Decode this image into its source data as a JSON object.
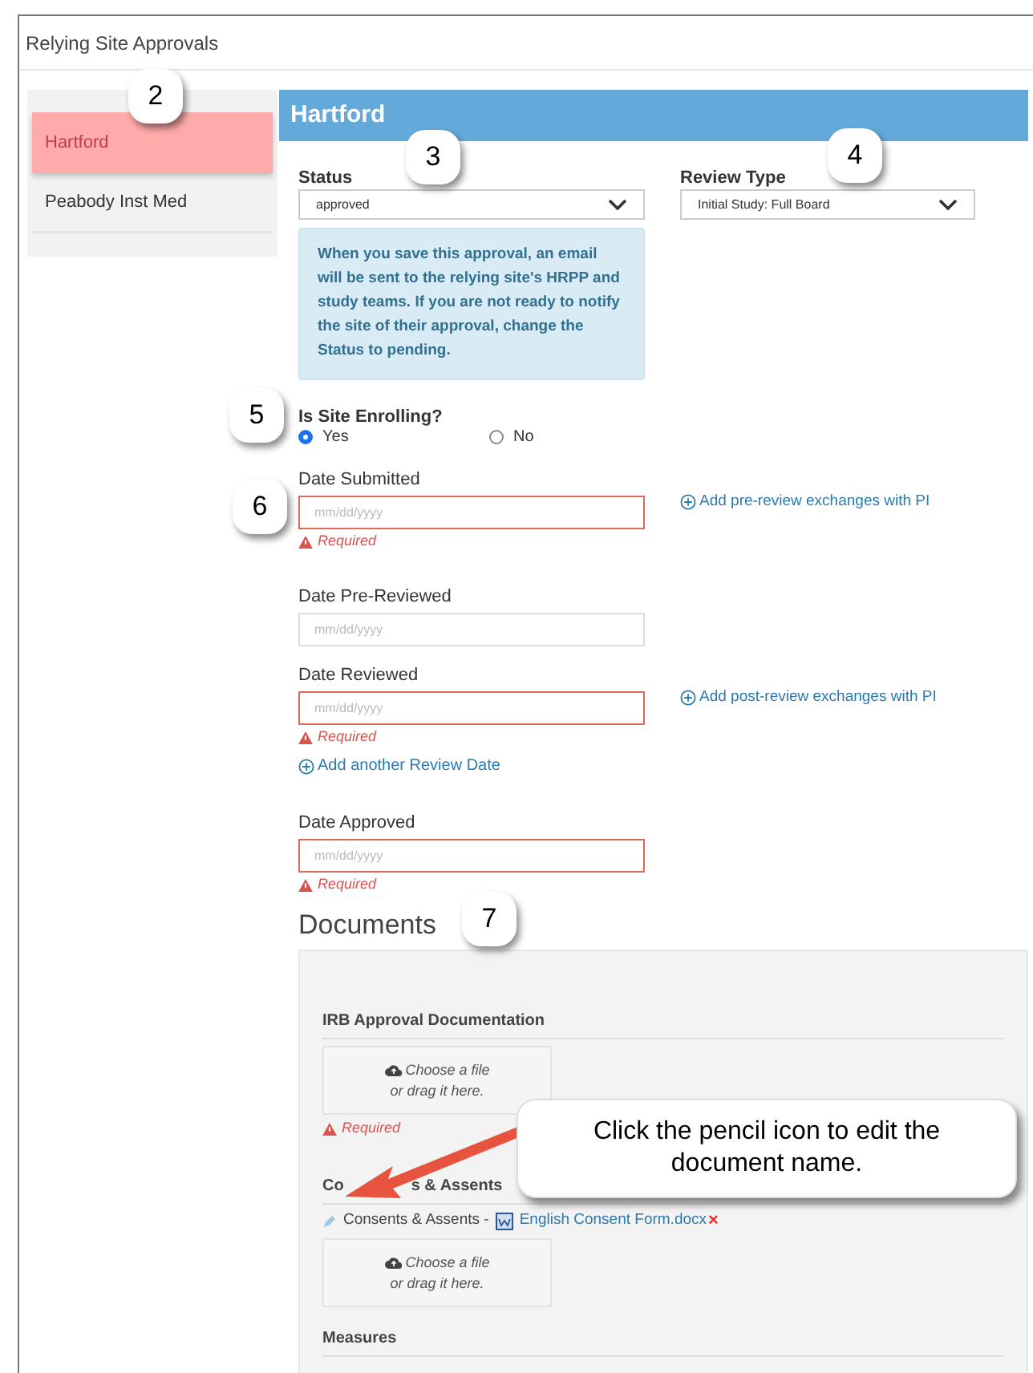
{
  "window": {
    "title": "Relying Site Approvals"
  },
  "sites": [
    {
      "name": "Hartford",
      "selected": true
    },
    {
      "name": "Peabody Inst Med",
      "selected": false
    }
  ],
  "panel": {
    "title": "Hartford",
    "status": {
      "label": "Status",
      "value": "approved"
    },
    "review_type": {
      "label": "Review Type",
      "value": "Initial Study: Full Board"
    },
    "notice": "When you save this approval, an email will be sent to the relying site's HRPP and study teams. If you are not ready to notify the site of their approval, change the Status to pending.",
    "enrolling": {
      "label": "Is Site Enrolling?",
      "options": [
        {
          "label": "Yes",
          "selected": true
        },
        {
          "label": "No",
          "selected": false
        }
      ]
    },
    "dates": [
      {
        "label": "Date Submitted",
        "placeholder": "mm/dd/yyyy",
        "required": true,
        "error": "Required",
        "link": "Add pre-review exchanges with PI"
      },
      {
        "label": "Date Pre-Reviewed",
        "placeholder": "mm/dd/yyyy",
        "required": false
      },
      {
        "label": "Date Reviewed",
        "placeholder": "mm/dd/yyyy",
        "required": true,
        "error": "Required",
        "link": "Add post-review exchanges with PI",
        "extra_link": "Add another Review Date"
      },
      {
        "label": "Date Approved",
        "placeholder": "mm/dd/yyyy",
        "required": true,
        "error": "Required"
      }
    ],
    "documents": {
      "title": "Documents",
      "sections": [
        {
          "title_parts": [
            "IRB Approval Documentation"
          ],
          "dropzone": [
            "Choose a file",
            "or drag it here."
          ],
          "error": "Required"
        },
        {
          "title_parts": [
            "Co",
            "s & Assents"
          ],
          "file": {
            "type_label": "Consents & Assents -",
            "name": "English Consent Form.docx",
            "remove": "×"
          },
          "dropzone": [
            "Choose a file",
            "or drag it here."
          ]
        },
        {
          "title_parts": [
            "Measures"
          ]
        }
      ]
    }
  },
  "step_badges": [
    {
      "number": "2"
    },
    {
      "number": "3"
    },
    {
      "number": "4"
    },
    {
      "number": "5"
    },
    {
      "number": "6"
    },
    {
      "number": "7"
    }
  ],
  "tooltip": "Click the pencil icon to edit the document name."
}
